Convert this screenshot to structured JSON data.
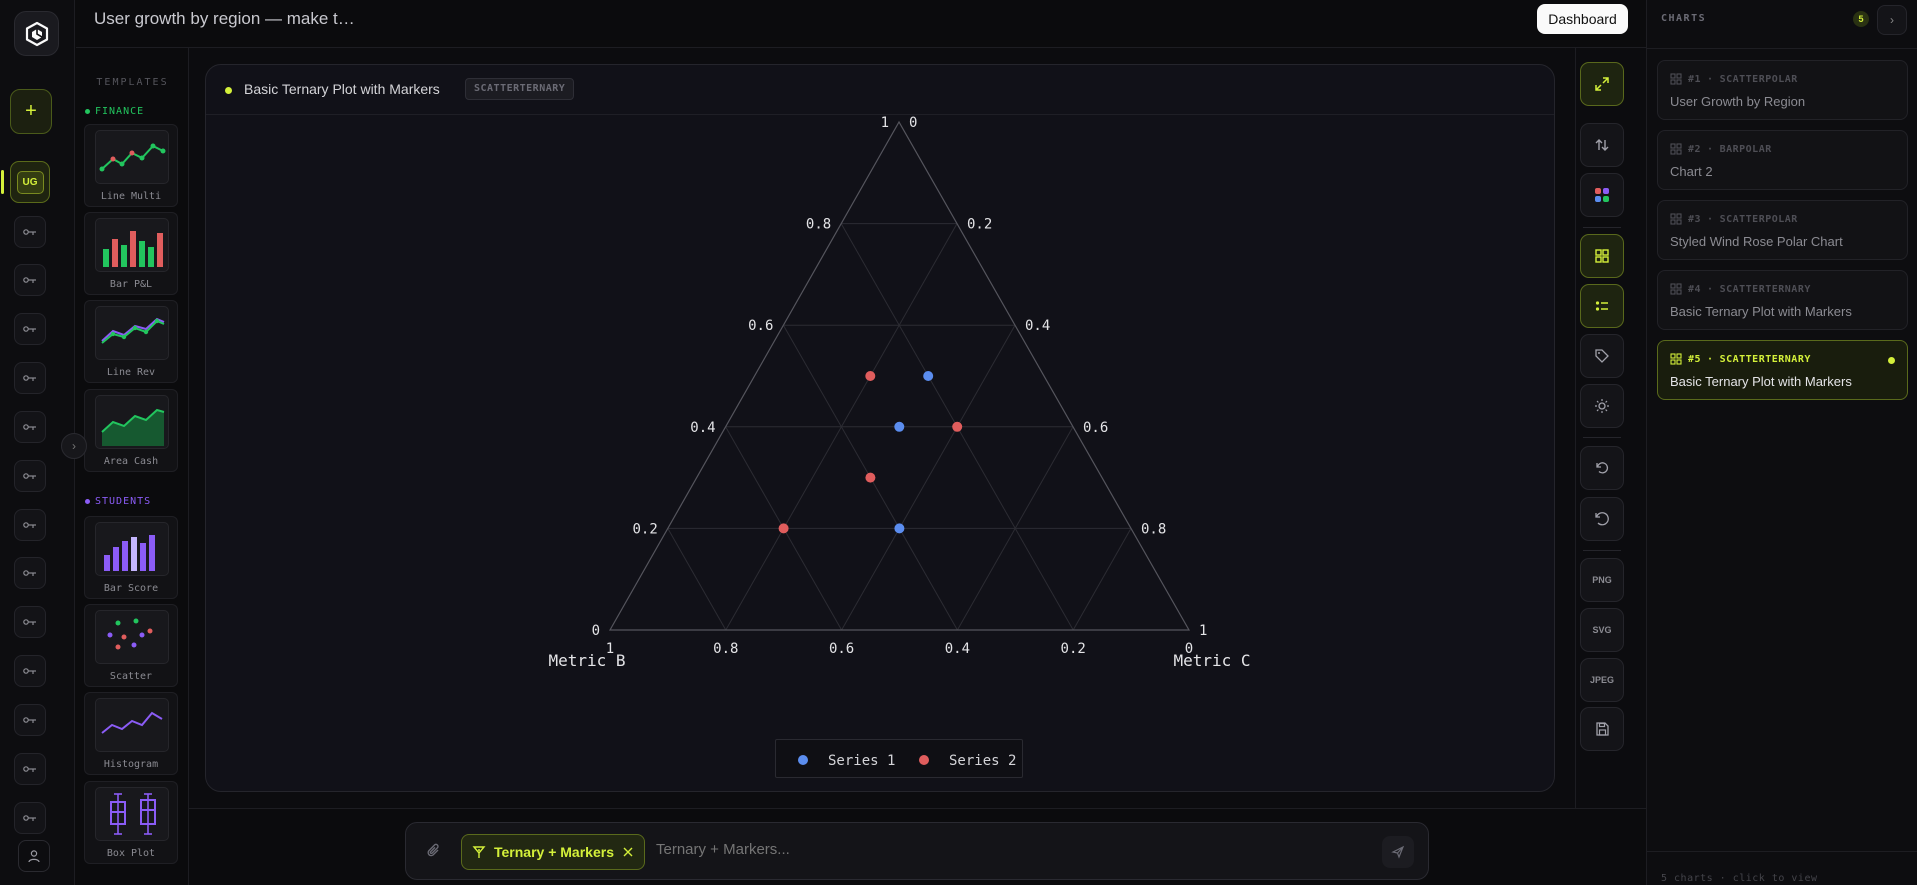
{
  "app": {
    "title": "User growth by region — make t…",
    "dashboard_label": "Dashboard"
  },
  "rail": {
    "active_initials": "UG"
  },
  "templates": {
    "heading": "TEMPLATES",
    "categories": [
      {
        "name": "FINANCE",
        "color": "#22c55e",
        "items": [
          "Line Multi",
          "Bar P&L",
          "Line Rev",
          "Area Cash"
        ]
      },
      {
        "name": "STUDENTS",
        "color": "#8b5cf6",
        "items": [
          "Bar Score",
          "Scatter",
          "Histogram",
          "Box Plot"
        ]
      }
    ]
  },
  "card": {
    "title": "Basic Ternary Plot with Markers",
    "badge": "SCATTERTERNARY"
  },
  "chart_data": {
    "type": "scatter",
    "subtype": "ternary",
    "axes": {
      "a": {
        "title": "",
        "ticks": [
          "0",
          "0.2",
          "0.4",
          "0.6",
          "0.8",
          "1"
        ]
      },
      "b": {
        "title": "Metric B",
        "ticks": [
          "1",
          "0.8",
          "0.6",
          "0.4",
          "0.2",
          "0"
        ]
      },
      "c": {
        "title": "Metric C",
        "ticks": [
          "0",
          "0.2",
          "0.4",
          "0.6",
          "0.8",
          "1"
        ]
      }
    },
    "grid": true,
    "legend_position": "bottom-center",
    "series": [
      {
        "name": "Series 1",
        "color": "#5b8def",
        "points": [
          {
            "a": 0.5,
            "b": 0.2,
            "c": 0.3
          },
          {
            "a": 0.4,
            "b": 0.3,
            "c": 0.3
          },
          {
            "a": 0.2,
            "b": 0.4,
            "c": 0.4
          }
        ]
      },
      {
        "name": "Series 2",
        "color": "#e05d5d",
        "points": [
          {
            "a": 0.5,
            "b": 0.3,
            "c": 0.2
          },
          {
            "a": 0.4,
            "b": 0.2,
            "c": 0.4
          },
          {
            "a": 0.3,
            "b": 0.4,
            "c": 0.3
          },
          {
            "a": 0.2,
            "b": 0.6,
            "c": 0.2
          }
        ]
      }
    ]
  },
  "tools": {
    "png": "PNG",
    "svg": "SVG",
    "jpeg": "JPEG"
  },
  "prompt": {
    "chip": "Ternary + Markers",
    "placeholder": "Ternary + Markers..."
  },
  "charts_panel": {
    "title": "CHARTS",
    "count": "5",
    "items": [
      {
        "num": "#1",
        "type": "SCATTERPOLAR",
        "name": "User Growth by Region"
      },
      {
        "num": "#2",
        "type": "BARPOLAR",
        "name": "Chart 2"
      },
      {
        "num": "#3",
        "type": "SCATTERPOLAR",
        "name": "Styled Wind Rose Polar Chart"
      },
      {
        "num": "#4",
        "type": "SCATTERTERNARY",
        "name": "Basic Ternary Plot with Markers"
      },
      {
        "num": "#5",
        "type": "SCATTERTERNARY",
        "name": "Basic Ternary Plot with Markers"
      }
    ],
    "footer": "5 charts · click to view"
  }
}
